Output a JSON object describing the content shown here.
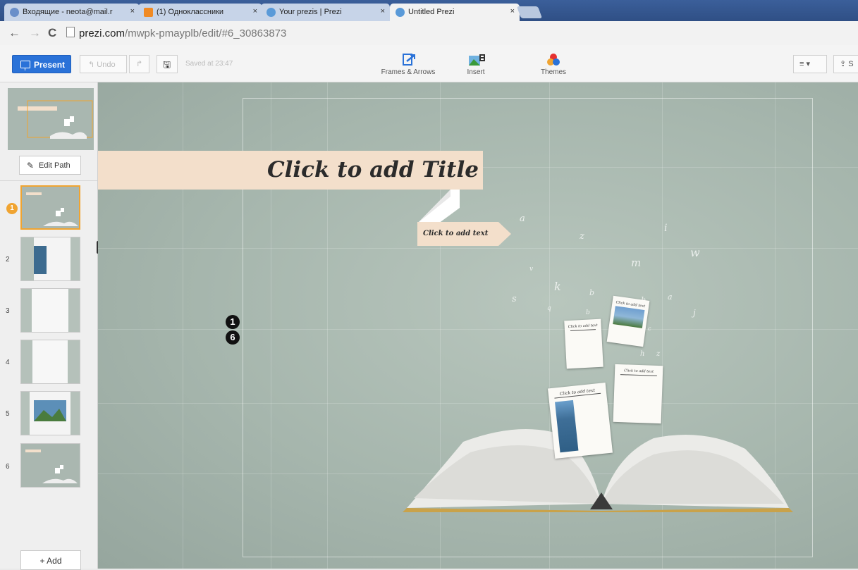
{
  "browser": {
    "tabs": [
      {
        "label": "Входящие - neota@mail.r",
        "fav_color": "#6a8fc9"
      },
      {
        "label": "(1) Одноклассники",
        "fav_color": "#f08a24"
      },
      {
        "label": "Your prezis | Prezi",
        "fav_color": "#5a9ad8"
      },
      {
        "label": "Untitled Prezi",
        "fav_color": "#5a9ad8"
      }
    ],
    "close_glyph": "×",
    "url_domain": "prezi.com",
    "url_path": "/mwpk-pmayplb/edit/#6_30863873",
    "back_glyph": "←",
    "forward_glyph": "→",
    "reload_glyph": "C"
  },
  "toolbar": {
    "present_label": "Present",
    "undo_label": "Undo",
    "undo_glyph": "↰",
    "redo_glyph": "↱",
    "save_glyph": "🖫",
    "saved_text": "Saved at 23:47",
    "tools": [
      {
        "label": "Frames & Arrows",
        "icon": "frames-arrows-icon"
      },
      {
        "label": "Insert",
        "icon": "insert-icon"
      },
      {
        "label": "Themes",
        "icon": "themes-icon"
      }
    ],
    "menu_glyph": "≡ ▾",
    "share_glyph": "⇪ S"
  },
  "sidebar": {
    "edit_path_label": "Edit Path",
    "add_label": "+ Add",
    "selected_badge": "1",
    "slides": [
      "1",
      "2",
      "3",
      "4",
      "5",
      "6"
    ]
  },
  "canvas": {
    "title": "Click to add Title",
    "subtitle": "Click to add text",
    "path_steps": [
      "1",
      "6"
    ],
    "card_title": "Click to add text",
    "accent_banner": "#f3dfcb",
    "background": "#a9b8af",
    "scatter_letters": [
      "a",
      "z",
      "i",
      "w",
      "m",
      "k",
      "b",
      "s",
      "h",
      "a",
      "j",
      "v",
      "q",
      "b",
      "c",
      "h",
      "z"
    ]
  }
}
